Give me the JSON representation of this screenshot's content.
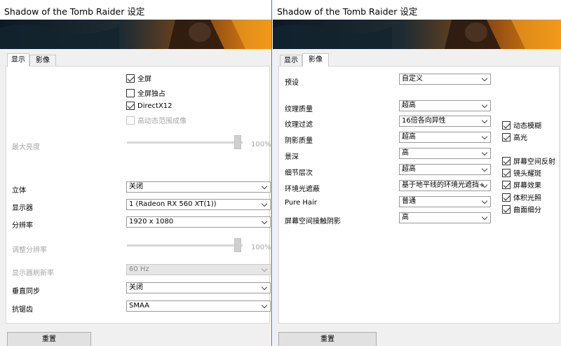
{
  "left": {
    "title": "Shadow of the Tomb Raider 设定",
    "tabs": [
      "显示",
      "影像"
    ],
    "active_tab": "显示",
    "checkboxes": {
      "fullscreen": {
        "label": "全屏",
        "checked": true
      },
      "exclusive_fullscreen": {
        "label": "全屏独占",
        "checked": false
      },
      "directx12": {
        "label": "DirectX12",
        "checked": true
      },
      "hdr": {
        "label": "高动态范围成像",
        "checked": false,
        "disabled": true
      }
    },
    "max_brightness": {
      "label": "最大亮度",
      "value": "100%"
    },
    "stereo": {
      "label": "立体",
      "value": "关闭"
    },
    "display": {
      "label": "显示器",
      "value": "1 (Radeon RX 560 XT(1))"
    },
    "resolution": {
      "label": "分辨率",
      "value": "1920 x 1080"
    },
    "resolution_scale": {
      "label": "调整分辨率",
      "value": "100%"
    },
    "refresh_rate": {
      "label": "显示器刷新率",
      "value": "60 Hz"
    },
    "vsync": {
      "label": "垂直同步",
      "value": "关闭"
    },
    "antialiasing": {
      "label": "抗锯齿",
      "value": "SMAA"
    },
    "reset_label": "重置"
  },
  "right": {
    "title": "Shadow of the Tomb Raider 设定",
    "tabs": [
      "显示",
      "影像"
    ],
    "active_tab": "影像",
    "preset": {
      "label": "预设",
      "value": "自定义"
    },
    "settings": [
      {
        "label": "纹理质量",
        "value": "超高"
      },
      {
        "label": "纹理过滤",
        "value": "16倍各向异性"
      },
      {
        "label": "阴影质量",
        "value": "超高"
      },
      {
        "label": "景深",
        "value": "高"
      },
      {
        "label": "细节层次",
        "value": "超高"
      },
      {
        "label": "环境光遮蔽",
        "value": "基于地平线的环境光遮挡+"
      },
      {
        "label": "Pure Hair",
        "value": "普通"
      },
      {
        "label": "屏幕空间接触阴影",
        "value": "高"
      }
    ],
    "checkboxes": [
      {
        "label": "动态模糊",
        "checked": true
      },
      {
        "label": "高光",
        "checked": true
      },
      {
        "label": "屏幕空间反射",
        "checked": true
      },
      {
        "label": "镜头耀斑",
        "checked": true
      },
      {
        "label": "屏幕效果",
        "checked": true
      },
      {
        "label": "体积光照",
        "checked": true
      },
      {
        "label": "曲面细分",
        "checked": true
      }
    ],
    "reset_label": "重置"
  }
}
